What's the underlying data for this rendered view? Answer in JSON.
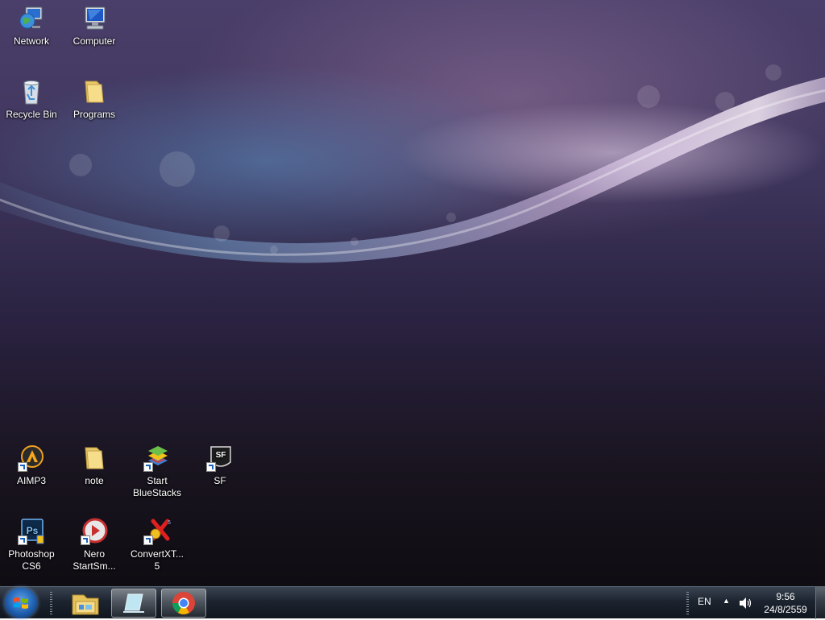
{
  "desktop": {
    "icons": [
      {
        "name": "network-icon",
        "label": "Network"
      },
      {
        "name": "computer-icon",
        "label": "Computer"
      },
      {
        "name": "recycle-bin-icon",
        "label": "Recycle Bin"
      },
      {
        "name": "programs-folder-icon",
        "label": "Programs"
      },
      {
        "name": "aimp3-icon",
        "label": "AIMP3"
      },
      {
        "name": "note-folder-icon",
        "label": "note"
      },
      {
        "name": "bluestacks-icon",
        "label": "Start\nBlueStacks"
      },
      {
        "name": "sf-icon",
        "label": "SF"
      },
      {
        "name": "photoshop-icon",
        "label": "Photoshop\nCS6"
      },
      {
        "name": "nero-icon",
        "label": "Nero\nStartSm..."
      },
      {
        "name": "convertxtodvd-icon",
        "label": "ConvertXT...\n5"
      }
    ]
  },
  "taskbar": {
    "pinned": [
      {
        "name": "windows-explorer-icon"
      },
      {
        "name": "desktop-app-icon"
      },
      {
        "name": "chrome-icon"
      }
    ],
    "tray": {
      "language": "EN",
      "time": "9:56",
      "date": "24/8/2559"
    }
  },
  "colors": {
    "accent": "#1f5fb0",
    "taskbar": "#1c2430"
  }
}
